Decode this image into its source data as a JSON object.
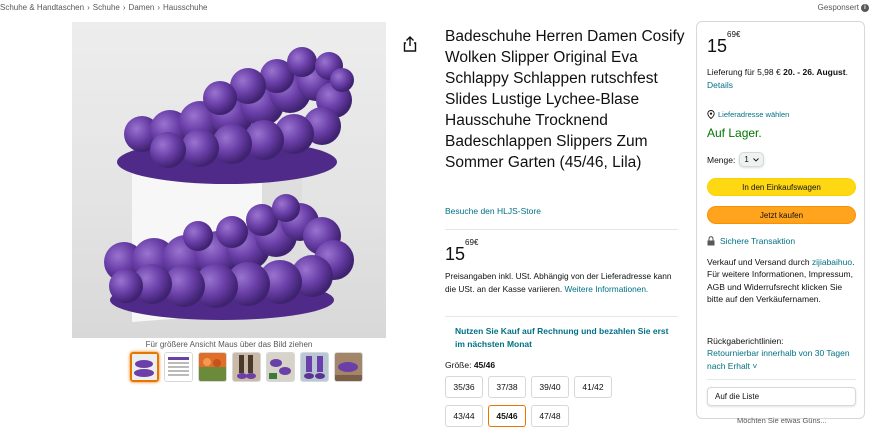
{
  "breadcrumb": [
    "Schuhe & Handtaschen",
    "Schuhe",
    "Damen",
    "Hausschuhe"
  ],
  "sponsored": "Gesponsert",
  "product": {
    "title": "Badeschuhe Herren Damen Cosify Wolken Slipper Original Eva Schlappy Schlappen rutschfest Slides Lustige Lychee-Blase Hausschuhe Trocknend Badeschlappen Slippers Zum Sommer Garten (45/46, Lila)",
    "store_link": "Besuche den HLJS-Store",
    "price_whole": "15",
    "price_fraction": "69",
    "currency": "€",
    "price_note_text": "Preisangaben inkl. USt. Abhängig von der Lieferadresse kann die USt. an der Kasse variieren.",
    "price_note_link": "Weitere Informationen.",
    "invoice_promo": "Nutzen Sie Kauf auf Rechnung und bezahlen Sie erst im nächsten Monat",
    "size_label": "Größe:",
    "size_selected": "45/46",
    "sizes": [
      "35/36",
      "37/38",
      "39/40",
      "41/42",
      "43/44",
      "45/46",
      "47/48"
    ]
  },
  "gallery": {
    "hint": "Für größere Ansicht Maus über das Bild ziehen",
    "thumb_count": 7
  },
  "buybox": {
    "price_whole": "15",
    "price_fraction": "69",
    "currency": "€",
    "delivery_prefix": "Lieferung für 5,98 €",
    "delivery_dates": "20. - 26. August",
    "delivery_details": "Details",
    "location": "Lieferadresse wählen",
    "stock": "Auf Lager.",
    "qty_label": "Menge:",
    "qty_value": "1",
    "cart_button": "In den Einkaufswagen",
    "buy_button": "Jetzt kaufen",
    "secure": "Sichere Transaktion",
    "sold_prefix": "Verkauf und Versand durch",
    "seller": "zijiabaihuo",
    "sold_suffix": ". Für weitere Informationen, Impressum, AGB und Widerrufsrecht klicken Sie bitte auf den Verkäufernamen.",
    "returns_label": "Rückgaberichtlinien:",
    "returns_link": "Retournierbar innerhalb von 30 Tagen nach Erhalt",
    "list_button": "Auf die Liste",
    "cut_text": "Möchten Sie etwas Güns..."
  },
  "colors": {
    "link": "#007185",
    "stock": "#007600",
    "cart_button": "#ffd814",
    "buy_button": "#ffa41c",
    "selected_border": "#e77600",
    "product_purple": "#6a3fa8"
  }
}
